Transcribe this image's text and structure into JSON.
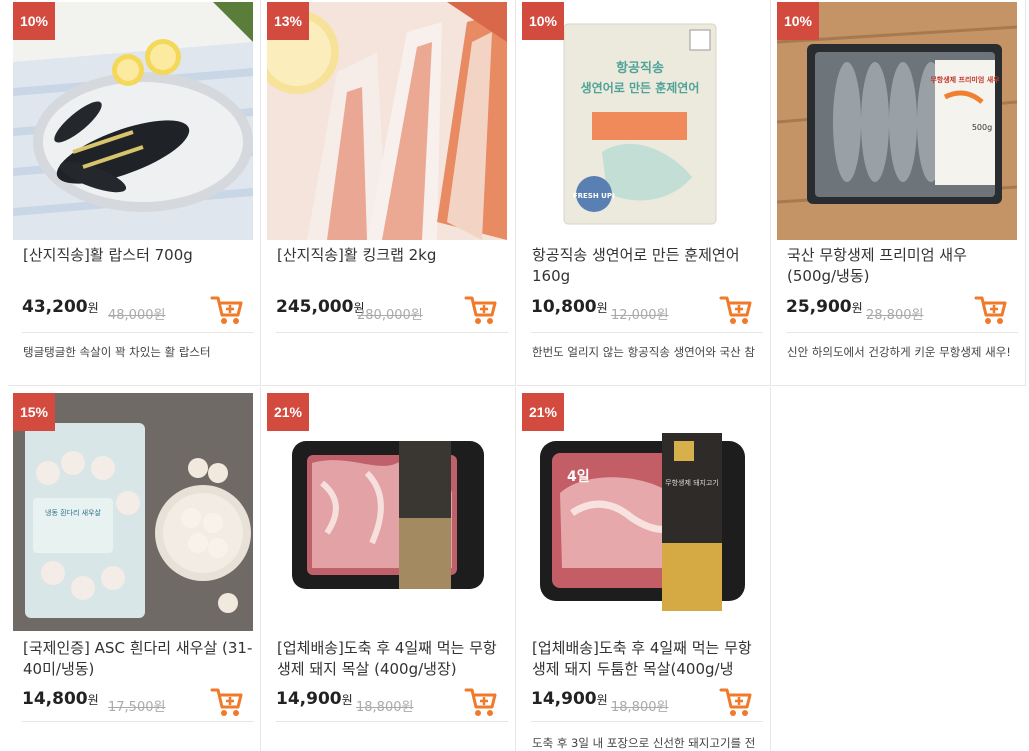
{
  "products": [
    {
      "discount": "10%",
      "title": "[산지직송]활 랍스터 700g",
      "price": "43,200",
      "won": "원",
      "orig": "48,000원",
      "desc": "탱글탱글한 속살이 꽉 차있는 활 랍스터"
    },
    {
      "discount": "13%",
      "title": "[산지직송]활 킹크랩 2kg",
      "price": "245,000",
      "won": "원",
      "orig": "280,000원",
      "desc": ""
    },
    {
      "discount": "10%",
      "title": "항공직송 생연어로 만든 훈제연어 160g",
      "price": "10,800",
      "won": "원",
      "orig": "12,000원",
      "desc": "한번도 얼리지 않는 항공직송 생연어와 국산 참"
    },
    {
      "discount": "10%",
      "title": "국산 무항생제 프리미엄 새우 (500g/냉동)",
      "price": "25,900",
      "won": "원",
      "orig": "28,800원",
      "desc": "신안 하의도에서 건강하게 키운 무항생제 새우!"
    },
    {
      "discount": "15%",
      "title": "[국제인증] ASC 흰다리 새우살 (31-40미/냉동)",
      "price": "14,800",
      "won": "원",
      "orig": "17,500원",
      "desc": ""
    },
    {
      "discount": "21%",
      "title": "[업체배송]도축 후 4일째 먹는 무항생제 돼지 목살 (400g/냉장)",
      "price": "14,900",
      "won": "원",
      "orig": "18,800원",
      "desc": ""
    },
    {
      "discount": "21%",
      "title": "[업체배송]도축 후 4일째 먹는 무항생제 돼지 두툼한 목살(400g/냉",
      "price": "14,900",
      "won": "원",
      "orig": "18,800원",
      "desc": "도축 후 3일 내 포장으로 신선한 돼지고기를 전"
    }
  ],
  "package_text": {
    "salmon_line1": "항공직송",
    "salmon_line2": "생연어로 만든 훈제연어",
    "salmon_badge": "FRESH UP!",
    "shrimp_pack": "무항생제 프리미엄 새우",
    "shrimp_weight": "500g",
    "frozen_label": "냉동 흰다리 새우살",
    "pork_label": "무항생제 돼지고기",
    "pork_days": "4일"
  },
  "colors": {
    "badge": "#d34a3f",
    "cart": "#f07a2a",
    "strike": "#aaaaaa"
  }
}
